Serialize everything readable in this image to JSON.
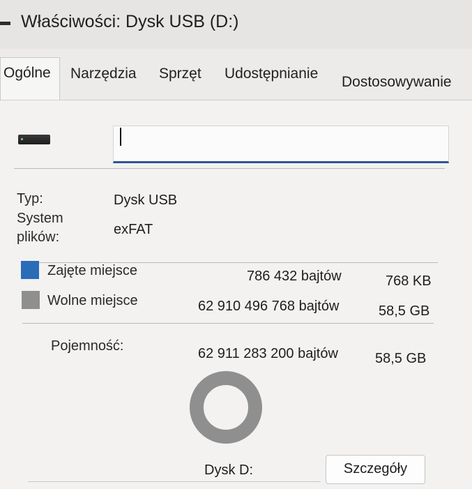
{
  "window": {
    "title": "Właściwości: Dysk USB (D:)"
  },
  "tabs": [
    "Ogólne",
    "Narzędzia",
    "Sprzęt",
    "Udostępnianie",
    "Dostosowywanie"
  ],
  "general": {
    "name_value": "",
    "type_label": "Typ:",
    "type_value": "Dysk USB",
    "fs_label_line1": "System",
    "fs_label_line2": "plików:",
    "fs_value": "exFAT",
    "used": {
      "label": "Zajęte miejsce",
      "bytes": "786 432 bajtów",
      "size": "768 KB",
      "color": "#2b6cb8"
    },
    "free": {
      "label": "Wolne miejsce",
      "bytes": "62 910 496 768 bajtów",
      "size": "58,5 GB",
      "color": "#8f8f8f"
    },
    "capacity": {
      "label": "Pojemność:",
      "bytes": "62 911 283 200 bajtów",
      "size": "58,5 GB"
    },
    "used_fraction": 1.25e-05,
    "drive_label": "Dysk D:",
    "details_button": "Szczegóły"
  }
}
